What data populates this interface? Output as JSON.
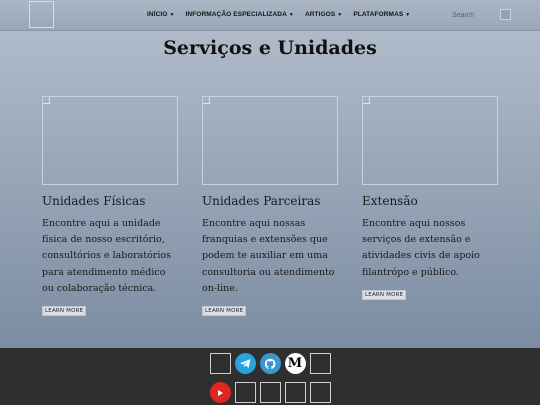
{
  "nav": {
    "menu": [
      {
        "label": "INÍCIO",
        "dropdown": true
      },
      {
        "label": "INFORMAÇÃO ESPECIALIZADA",
        "dropdown": true
      },
      {
        "label": "ARTIGOS",
        "dropdown": true
      },
      {
        "label": "PLATAFORMAS",
        "dropdown": true
      }
    ],
    "search_placeholder": "Search"
  },
  "page": {
    "title": "Serviços e Unidades"
  },
  "cards": [
    {
      "title": "Unidades Físicas",
      "text": "Encontre aqui a unidade física de nosso escritório, consultórios e laboratórios para atendimento médico ou colaboração técnica.",
      "button": "LEARN MORE"
    },
    {
      "title": "Unidades Parceiras",
      "text": "Encontre aqui nossas franquias e extensões que podem te auxiliar em uma consultoria ou atendimento on-line.",
      "button": "LEARN MORE"
    },
    {
      "title": "Extensão",
      "text": "Encontre aqui nossos serviços de extensão e atividades civis de apoio filantrópo e público.",
      "button": "LEARN MORE"
    }
  ],
  "footer": {
    "row1": [
      "image-icon",
      "telegram-icon",
      "github-icon",
      "medium-icon",
      "image-icon"
    ],
    "row2": [
      "youtube-icon",
      "image-icon",
      "image-icon",
      "image-icon",
      "image-icon"
    ],
    "medium_glyph": "M",
    "colors": {
      "telegram": "#2aa3dc",
      "github": "#3b95cf",
      "youtube": "#e02623",
      "footer_bg": "#2f2f2f"
    }
  }
}
